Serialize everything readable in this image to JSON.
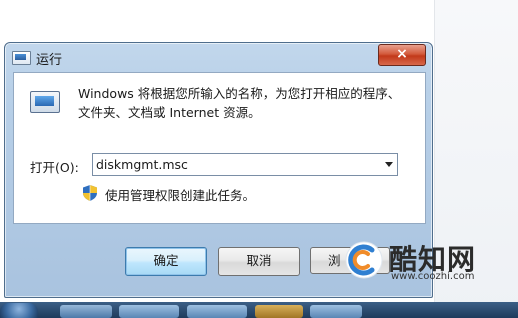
{
  "window": {
    "title": "运行",
    "close_label": "×"
  },
  "dialog": {
    "description": "Windows 将根据您所输入的名称，为您打开相应的程序、文件夹、文档或 Internet 资源。",
    "open_label": "打开(O):",
    "input_value": "diskmgmt.msc",
    "admin_note": "使用管理权限创建此任务。"
  },
  "buttons": {
    "ok_label": "确定",
    "cancel_label": "取消",
    "browse_label": "浏"
  },
  "watermark": {
    "brand": "酷知网",
    "url": "www.coozhi.com"
  },
  "icons": {
    "title": "run-app-icon",
    "app": "run-app-icon",
    "shield": "uac-shield-icon",
    "dropdown": "chevron-down-icon",
    "watermark_logo": "coozhi-logo-icon"
  },
  "colors": {
    "title_bar": "#b8d0e8",
    "close_button": "#c2391a",
    "ok_button_border": "#3d7bad",
    "taskbar": "#1e3b5c",
    "watermark_orange": "#f08c2a",
    "watermark_blue": "#2f7fd1"
  }
}
